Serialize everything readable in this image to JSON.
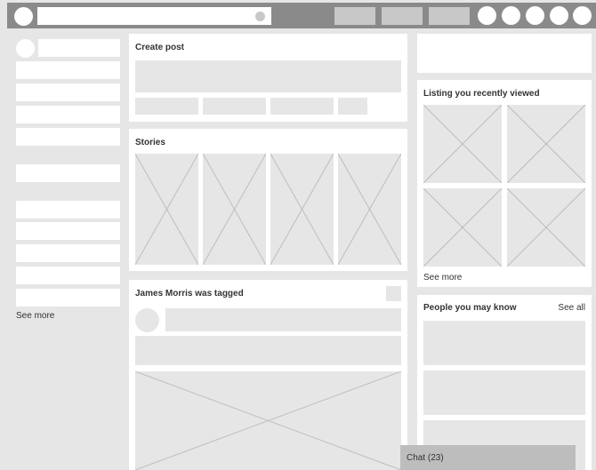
{
  "header": {
    "search": {
      "value": ""
    },
    "nav_button_count": 3,
    "icon_button_count": 5
  },
  "left_sidebar": {
    "see_more": "See more"
  },
  "create_post": {
    "title": "Create post"
  },
  "stories": {
    "title": "Stories"
  },
  "feed_post": {
    "title": "James Morris was tagged"
  },
  "right_sidebar": {
    "listing": {
      "title": "Listing you recently viewed",
      "see_more": "See more"
    },
    "people": {
      "title": "People you may know",
      "see_all": "See all"
    }
  },
  "chat": {
    "label": "Chat (23)"
  },
  "colors": {
    "background": "#e6e6e6",
    "topbar": "#8a8a8a",
    "panel": "#ffffff",
    "placeholder": "#e6e6e6",
    "chat_bar": "#bdbdbd"
  }
}
